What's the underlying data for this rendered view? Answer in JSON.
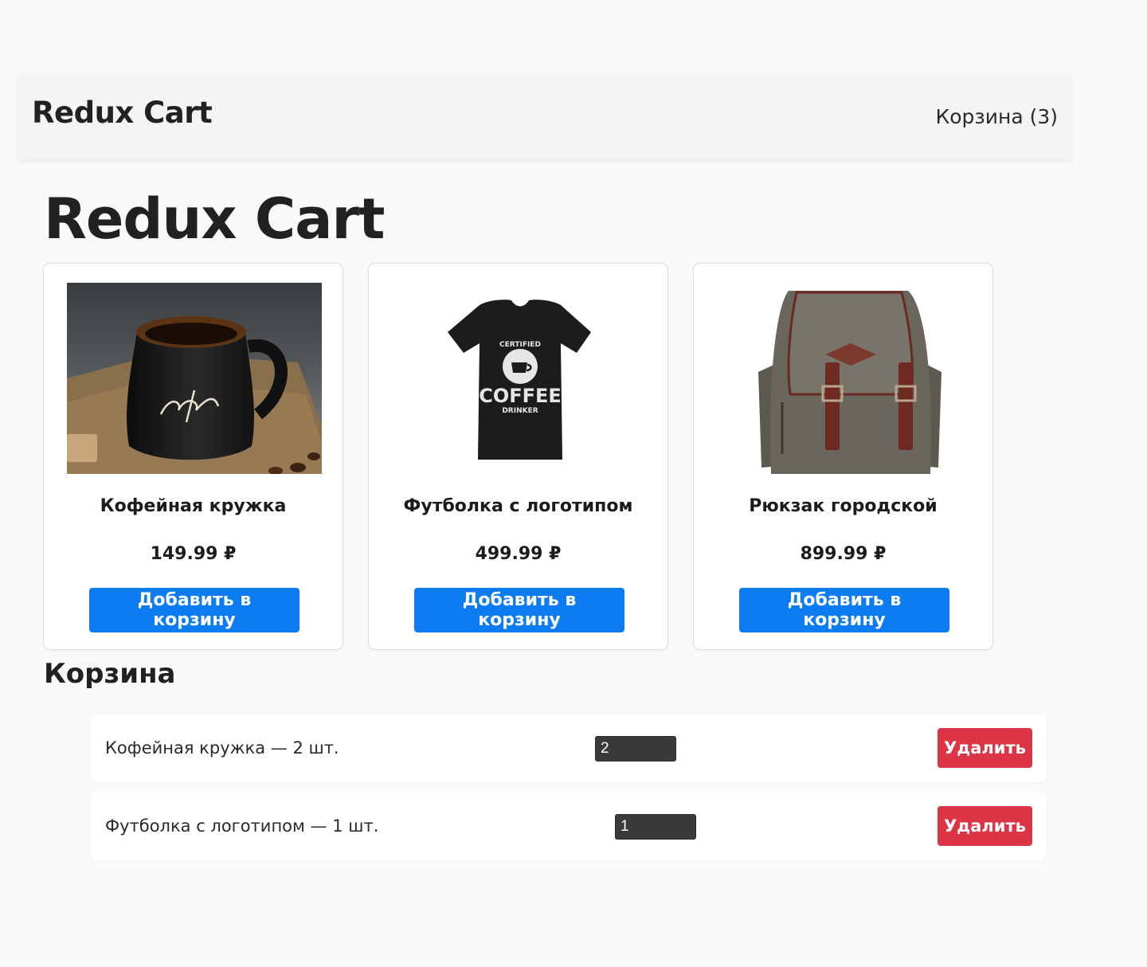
{
  "header": {
    "brand": "Redux Cart",
    "cart_link": "Корзина (3)"
  },
  "page_title": "Redux Cart",
  "products": [
    {
      "name": "Кофейная кружка",
      "price": "149.99 ₽",
      "button": "Добавить в корзину",
      "image": "coffee-mug-image"
    },
    {
      "name": "Футболка с логотипом",
      "price": "499.99 ₽",
      "button": "Добавить в корзину",
      "image": "tshirt-image",
      "image_text": [
        "CERTIFIED",
        "COFFEE",
        "DRINKER"
      ]
    },
    {
      "name": "Рюкзак городской",
      "price": "899.99 ₽",
      "button": "Добавить в корзину",
      "image": "backpack-image"
    }
  ],
  "cart": {
    "heading": "Корзина",
    "items": [
      {
        "label": "Кофейная кружка — 2 шт.",
        "quantity": "2",
        "delete": "Удалить"
      },
      {
        "label": "Футболка с логотипом — 1 шт.",
        "quantity": "1",
        "delete": "Удалить"
      }
    ]
  },
  "colors": {
    "primary": "#0b7cf2",
    "danger": "#dc3545",
    "background": "#f9f9f9"
  }
}
